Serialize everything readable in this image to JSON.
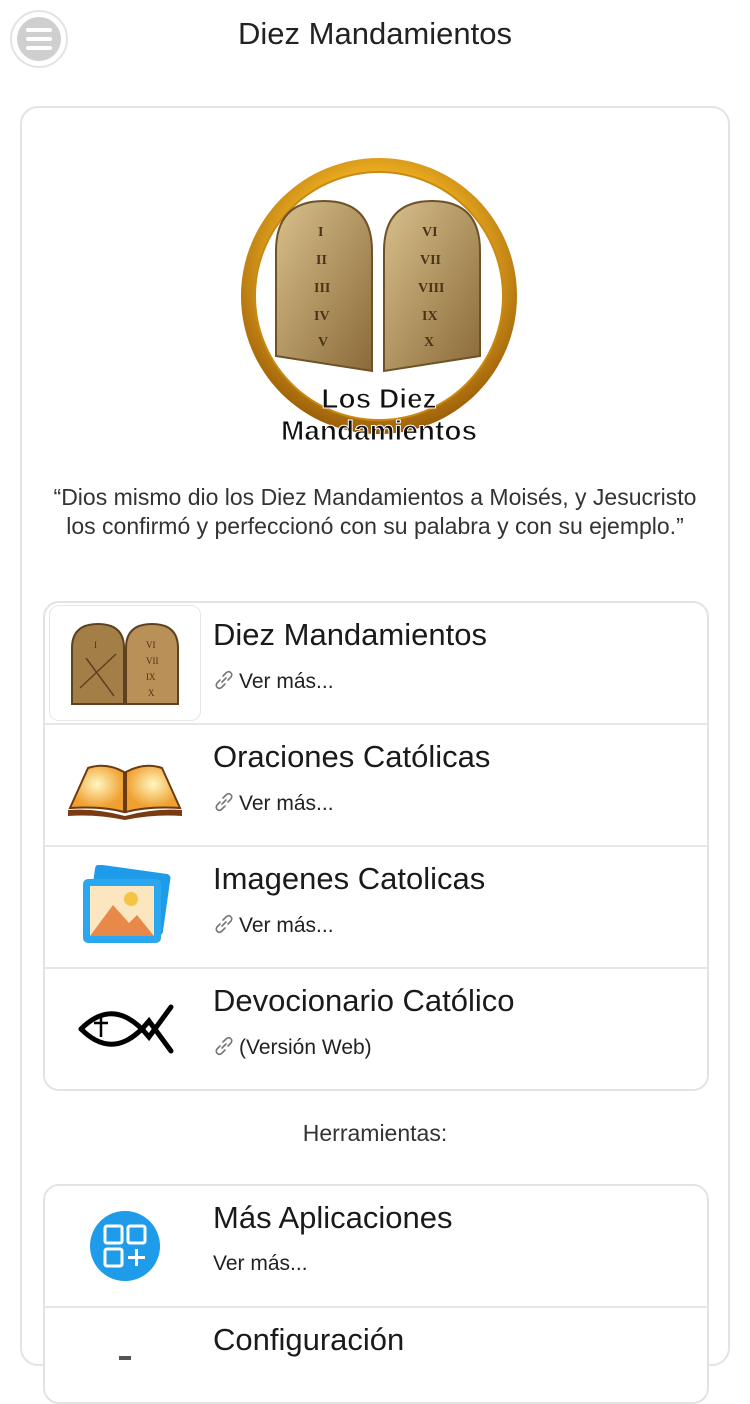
{
  "header": {
    "title": "Diez Mandamientos",
    "menu_icon": "menu-icon"
  },
  "logo": {
    "line1": "Los Diez",
    "line2": "Mandamientos"
  },
  "quote": "“Dios mismo dio los Diez Mandamientos a Moisés, y Jesucristo los confirmó y perfeccionó con su palabra y con su ejemplo.”",
  "main_list": [
    {
      "title": "Diez Mandamientos",
      "link": "Ver más...",
      "icon": "stone-tablets-icon"
    },
    {
      "title": "Oraciones Católicas",
      "link": "Ver más...",
      "icon": "open-bible-icon"
    },
    {
      "title": "Imagenes Catolicas",
      "link": "Ver más...",
      "icon": "image-gallery-icon"
    },
    {
      "title": "Devocionario Católico",
      "link": "(Versión Web)",
      "icon": "ichthys-fish-icon"
    }
  ],
  "tools": {
    "label": "Herramientas:",
    "items": [
      {
        "title": "Más Aplicaciones",
        "link": "Ver más...",
        "icon": "apps-add-icon"
      },
      {
        "title": "Configuración",
        "icon": "settings-icon"
      }
    ]
  },
  "colors": {
    "accent_blue": "#1e9be9",
    "gold": "#e0a42a",
    "border": "#e3e3e3"
  }
}
